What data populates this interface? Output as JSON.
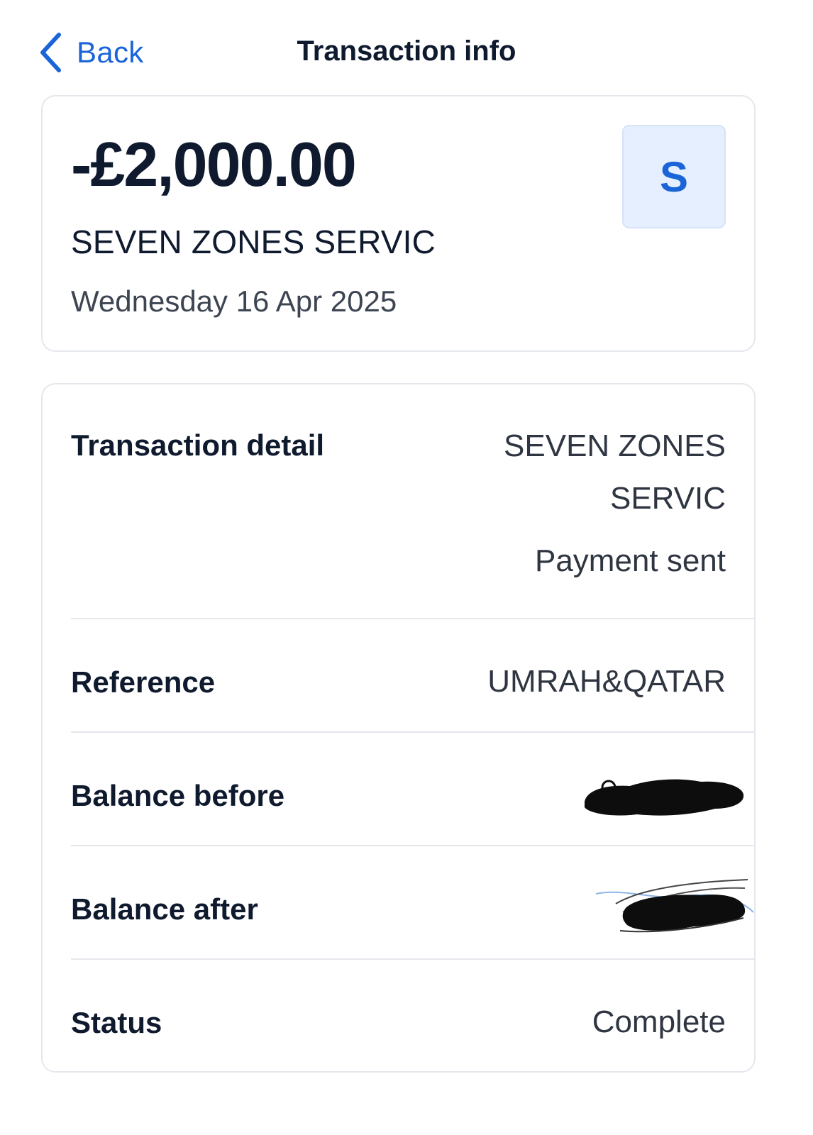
{
  "header": {
    "back_label": "Back",
    "title": "Transaction info"
  },
  "summary": {
    "amount": "-£2,000.00",
    "merchant": "SEVEN ZONES SERVIC",
    "date": "Wednesday 16 Apr 2025",
    "avatar_letter": "S"
  },
  "details": {
    "transaction_detail": {
      "label": "Transaction detail",
      "value_line1": "SEVEN ZONES",
      "value_line2": "SERVIC",
      "value_line3": "Payment sent"
    },
    "reference": {
      "label": "Reference",
      "value": "UMRAH&QATAR"
    },
    "balance_before": {
      "label": "Balance before"
    },
    "balance_after": {
      "label": "Balance after"
    },
    "status": {
      "label": "Status",
      "value": "Complete"
    }
  },
  "colors": {
    "accent": "#1a64d8",
    "avatar_bg": "#e6efff",
    "text": "#0f1a2e",
    "divider": "#e4e7ec"
  },
  "icons": {
    "back": "chevron-left-icon"
  }
}
